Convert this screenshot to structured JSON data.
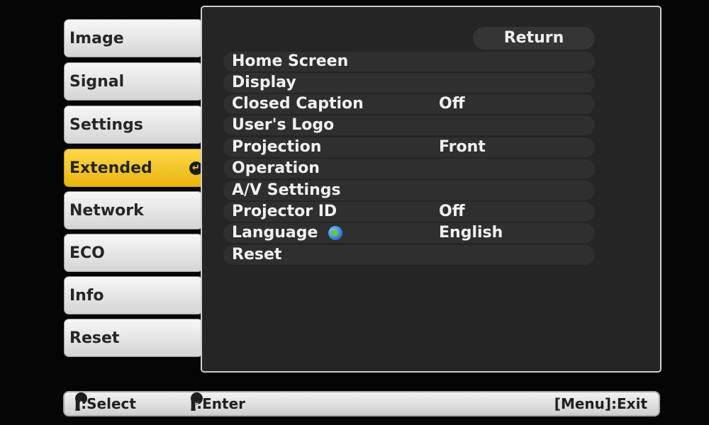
{
  "sidebar": {
    "items": [
      {
        "label": "Image"
      },
      {
        "label": "Signal"
      },
      {
        "label": "Settings"
      },
      {
        "label": "Extended"
      },
      {
        "label": "Network"
      },
      {
        "label": "ECO"
      },
      {
        "label": "Info"
      },
      {
        "label": "Reset"
      }
    ]
  },
  "panel": {
    "return_label": "Return",
    "rows": [
      {
        "label": "Home Screen",
        "value": ""
      },
      {
        "label": "Display",
        "value": ""
      },
      {
        "label": "Closed Caption",
        "value": "Off"
      },
      {
        "label": "User's Logo",
        "value": ""
      },
      {
        "label": "Projection",
        "value": "Front"
      },
      {
        "label": "Operation",
        "value": ""
      },
      {
        "label": "A/V Settings",
        "value": ""
      },
      {
        "label": "Projector ID",
        "value": "Off"
      },
      {
        "label": "Language",
        "value": "English"
      },
      {
        "label": "Reset",
        "value": ""
      }
    ]
  },
  "footer": {
    "select_prefix": "[",
    "select_suffix": "]:Select",
    "enter_prefix": "[",
    "enter_suffix": "]:Enter",
    "exit_label": "[Menu]:Exit"
  },
  "colors": {
    "active_tab": "#f2c21c",
    "tab": "#e6e6e6",
    "panel": "#252525",
    "row": "#2f2f2f",
    "text": "#f1f1f1"
  }
}
